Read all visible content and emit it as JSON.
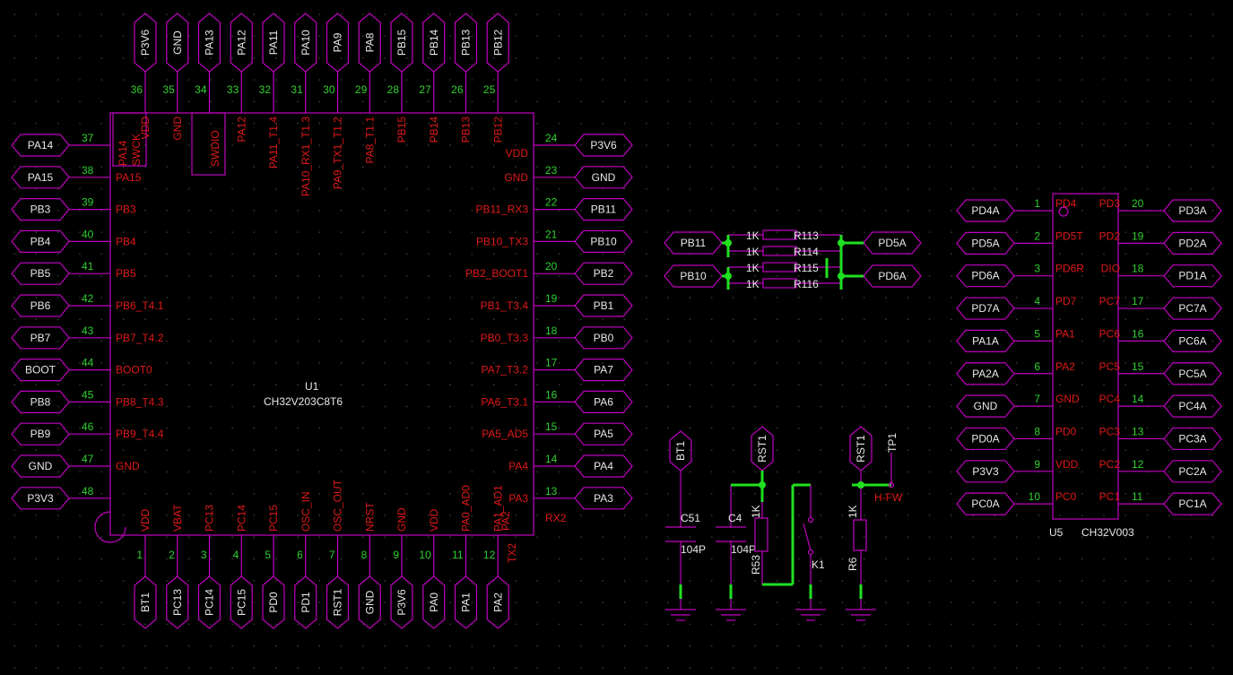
{
  "u1": {
    "ref": "U1",
    "value": "CH32V203C8T6",
    "top_pins": [
      {
        "num": "36",
        "func": "VDD",
        "net": "P3V6"
      },
      {
        "num": "35",
        "func": "GND",
        "net": "GND"
      },
      {
        "num": "34",
        "func": "PA13",
        "net": "PA13"
      },
      {
        "num": "33",
        "func": "PA12",
        "net": "PA12"
      },
      {
        "num": "32",
        "func": "PA11_T1.4",
        "net": "PA11"
      },
      {
        "num": "31",
        "func": "PA10_RX1_T1.3",
        "net": "PA10"
      },
      {
        "num": "30",
        "func": "PA9_TX1_T1.2",
        "net": "PA9"
      },
      {
        "num": "29",
        "func": "PA8_T1.1",
        "net": "PA8"
      },
      {
        "num": "28",
        "func": "PB15",
        "net": "PB15"
      },
      {
        "num": "27",
        "func": "PB14",
        "net": "PB14"
      },
      {
        "num": "26",
        "func": "PB13",
        "net": "PB13"
      },
      {
        "num": "25",
        "func": "PB12",
        "net": "PB12"
      }
    ],
    "top_extra": {
      "swck_a": "PA14",
      "swck_b": "SWCK",
      "swdio": "SWDIO"
    },
    "left_pins": [
      {
        "num": "37",
        "func": "",
        "net": "PA14"
      },
      {
        "num": "38",
        "func": "PA15",
        "net": "PA15"
      },
      {
        "num": "39",
        "func": "PB3",
        "net": "PB3"
      },
      {
        "num": "40",
        "func": "PB4",
        "net": "PB4"
      },
      {
        "num": "41",
        "func": "PB5",
        "net": "PB5"
      },
      {
        "num": "42",
        "func": "PB6_T4.1",
        "net": "PB6"
      },
      {
        "num": "43",
        "func": "PB7_T4.2",
        "net": "PB7"
      },
      {
        "num": "44",
        "func": "BOOT0",
        "net": "BOOT"
      },
      {
        "num": "45",
        "func": "PB8_T4.3",
        "net": "PB8"
      },
      {
        "num": "46",
        "func": "PB9_T4.4",
        "net": "PB9"
      },
      {
        "num": "47",
        "func": "GND",
        "net": "GND"
      },
      {
        "num": "48",
        "func": "",
        "net": "P3V3"
      }
    ],
    "right_pins": [
      {
        "num": "24",
        "func": "VDD",
        "net": "P3V6"
      },
      {
        "num": "23",
        "func": "GND",
        "net": "GND"
      },
      {
        "num": "22",
        "func": "PB11_RX3",
        "net": "PB11"
      },
      {
        "num": "21",
        "func": "PB10_TX3",
        "net": "PB10"
      },
      {
        "num": "20",
        "func": "PB2_BOOT1",
        "net": "PB2"
      },
      {
        "num": "19",
        "func": "PB1_T3.4",
        "net": "PB1"
      },
      {
        "num": "18",
        "func": "PB0_T3.3",
        "net": "PB0"
      },
      {
        "num": "17",
        "func": "PA7_T3.2",
        "net": "PA7"
      },
      {
        "num": "16",
        "func": "PA6_T3.1",
        "net": "PA6"
      },
      {
        "num": "15",
        "func": "PA5_AD5",
        "net": "PA5"
      },
      {
        "num": "14",
        "func": "PA4",
        "net": "PA4"
      },
      {
        "num": "13",
        "func": "PA3",
        "net": "PA3"
      }
    ],
    "rx2": "RX2",
    "bottom_pins": [
      {
        "num": "1",
        "func": "VDD",
        "net": "BT1"
      },
      {
        "num": "2",
        "func": "VBAT",
        "net": "PC13"
      },
      {
        "num": "3",
        "func": "PC13",
        "net": "PC14"
      },
      {
        "num": "4",
        "func": "PC14",
        "net": "PC15"
      },
      {
        "num": "5",
        "func": "PC15",
        "net": "PD0"
      },
      {
        "num": "6",
        "func": "OSC_IN",
        "net": "PD1"
      },
      {
        "num": "7",
        "func": "OSC_OUT",
        "net": "RST1"
      },
      {
        "num": "8",
        "func": "NRST",
        "net": "GND"
      },
      {
        "num": "9",
        "func": "GND",
        "net": "P3V6"
      },
      {
        "num": "10",
        "func": "VDD",
        "net": "PA0"
      },
      {
        "num": "11",
        "func": "PA0_AD0",
        "net": "PA1"
      },
      {
        "num": "12",
        "func": "PA1_AD1",
        "net": "PA2"
      }
    ],
    "bottom_extra": {
      "pa2": "PA2",
      "tx2": "TX2"
    }
  },
  "resistor_array": {
    "left_nets": [
      "PB11",
      "PB10"
    ],
    "right_nets": [
      "PD5A",
      "PD6A"
    ],
    "values": [
      "1K",
      "1K",
      "1K",
      "1K"
    ],
    "refs": [
      "R113",
      "R114",
      "R115",
      "R116"
    ]
  },
  "reset_circuit": {
    "ports": [
      "BT1",
      "RST1",
      "RST1",
      "TP1"
    ],
    "caps": [
      {
        "ref": "C51",
        "value": "104P"
      },
      {
        "ref": "C4",
        "value": "104P"
      }
    ],
    "r53": {
      "ref": "R53",
      "value": "1K"
    },
    "r6": {
      "ref": "R6",
      "value": "1K"
    },
    "switch": "K1",
    "net_label": "H-FW"
  },
  "u5": {
    "ref": "U5",
    "value": "CH32V003",
    "left_pins": [
      {
        "num": "1",
        "func": "PD4",
        "net": "PD4A"
      },
      {
        "num": "2",
        "func": "PD5T",
        "net": "PD5A"
      },
      {
        "num": "3",
        "func": "PD6R",
        "net": "PD6A"
      },
      {
        "num": "4",
        "func": "PD7",
        "net": "PD7A"
      },
      {
        "num": "5",
        "func": "PA1",
        "net": "PA1A"
      },
      {
        "num": "6",
        "func": "PA2",
        "net": "PA2A"
      },
      {
        "num": "7",
        "func": "GND",
        "net": "GND"
      },
      {
        "num": "8",
        "func": "PD0",
        "net": "PD0A"
      },
      {
        "num": "9",
        "func": "VDD",
        "net": "P3V3"
      },
      {
        "num": "10",
        "func": "PC0",
        "net": "PC0A"
      }
    ],
    "right_pins": [
      {
        "num": "20",
        "func": "PD3",
        "net": "PD3A"
      },
      {
        "num": "19",
        "func": "PD2",
        "net": "PD2A"
      },
      {
        "num": "18",
        "func": "DIO",
        "net": "PD1A"
      },
      {
        "num": "17",
        "func": "PC7",
        "net": "PC7A"
      },
      {
        "num": "16",
        "func": "PC6",
        "net": "PC6A"
      },
      {
        "num": "15",
        "func": "PC5",
        "net": "PC5A"
      },
      {
        "num": "14",
        "func": "PC4",
        "net": "PC4A"
      },
      {
        "num": "13",
        "func": "PC3",
        "net": "PC3A"
      },
      {
        "num": "12",
        "func": "PC2",
        "net": "PC2A"
      },
      {
        "num": "11",
        "func": "PC1",
        "net": "PC1A"
      }
    ]
  },
  "colors": {
    "background": "#000000",
    "wire": "#c000c0",
    "net_wire": "#20e020",
    "pin_name": "#e01818",
    "pin_number": "#30d030",
    "label": "#e8e8e8"
  }
}
